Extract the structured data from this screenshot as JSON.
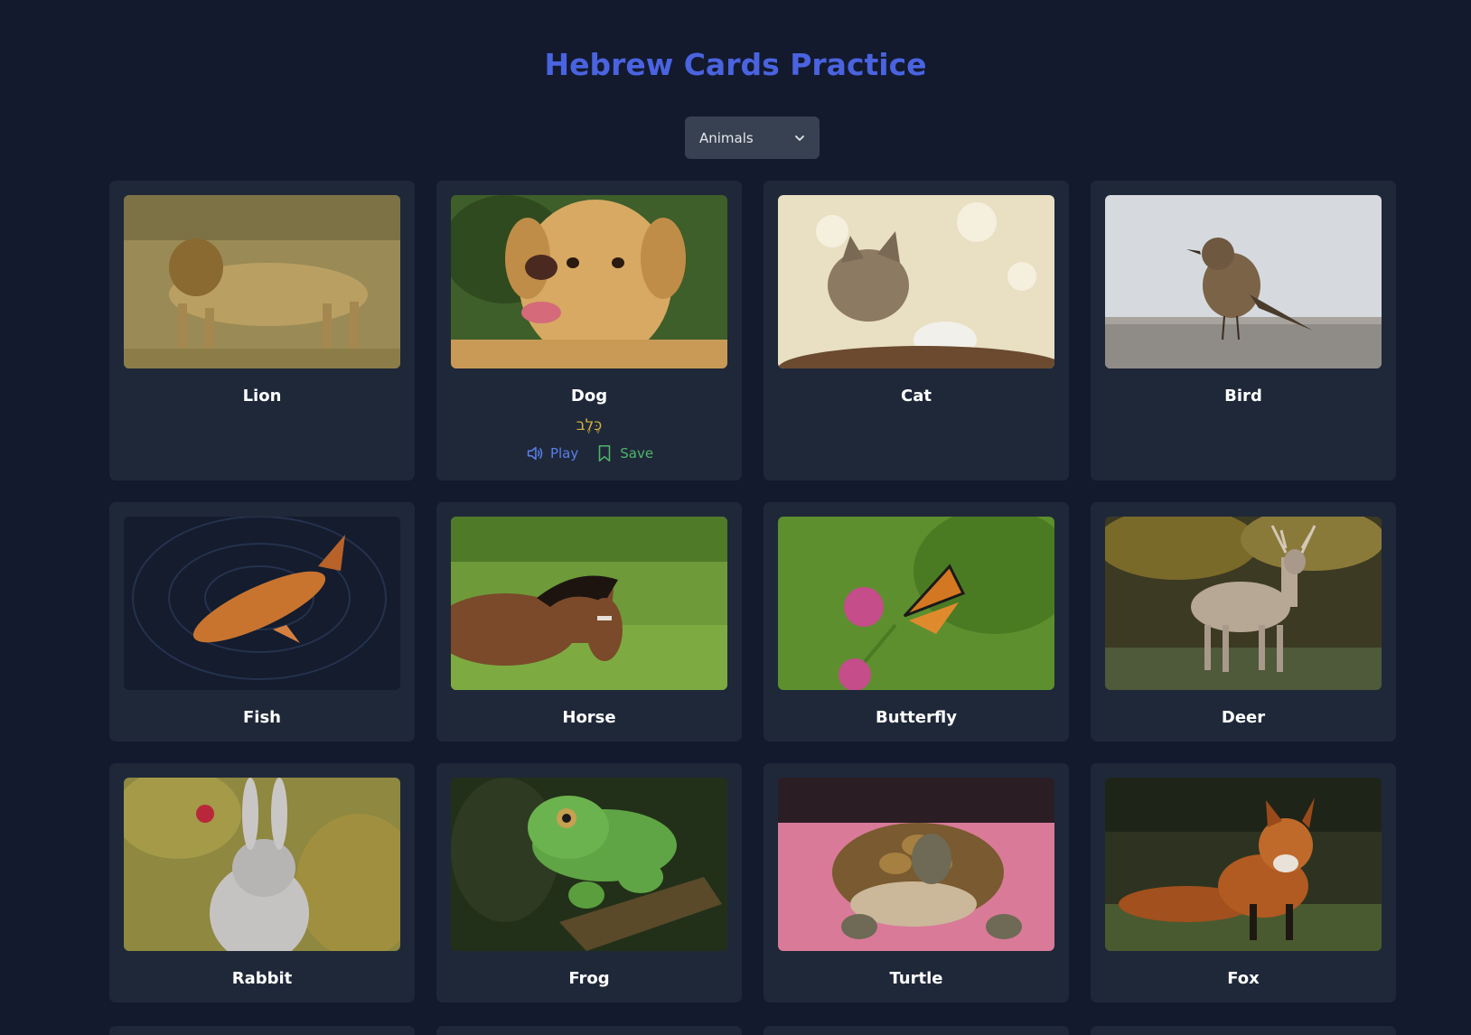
{
  "page": {
    "title": "Hebrew Cards Practice"
  },
  "category_select": {
    "value": "Animals"
  },
  "cards": [
    {
      "name": "Lion"
    },
    {
      "name": "Dog",
      "hebrew": "כֶּלֶב",
      "play_label": "Play",
      "save_label": "Save"
    },
    {
      "name": "Cat"
    },
    {
      "name": "Bird"
    },
    {
      "name": "Fish"
    },
    {
      "name": "Horse"
    },
    {
      "name": "Butterfly"
    },
    {
      "name": "Deer"
    },
    {
      "name": "Rabbit"
    },
    {
      "name": "Frog"
    },
    {
      "name": "Turtle"
    },
    {
      "name": "Fox"
    }
  ],
  "colors": {
    "background": "#131a2e",
    "card": "#1f2839",
    "title": "#4a63e0",
    "hebrew": "#d4b13f",
    "play": "#5b7ee8",
    "save": "#4fb46a"
  }
}
